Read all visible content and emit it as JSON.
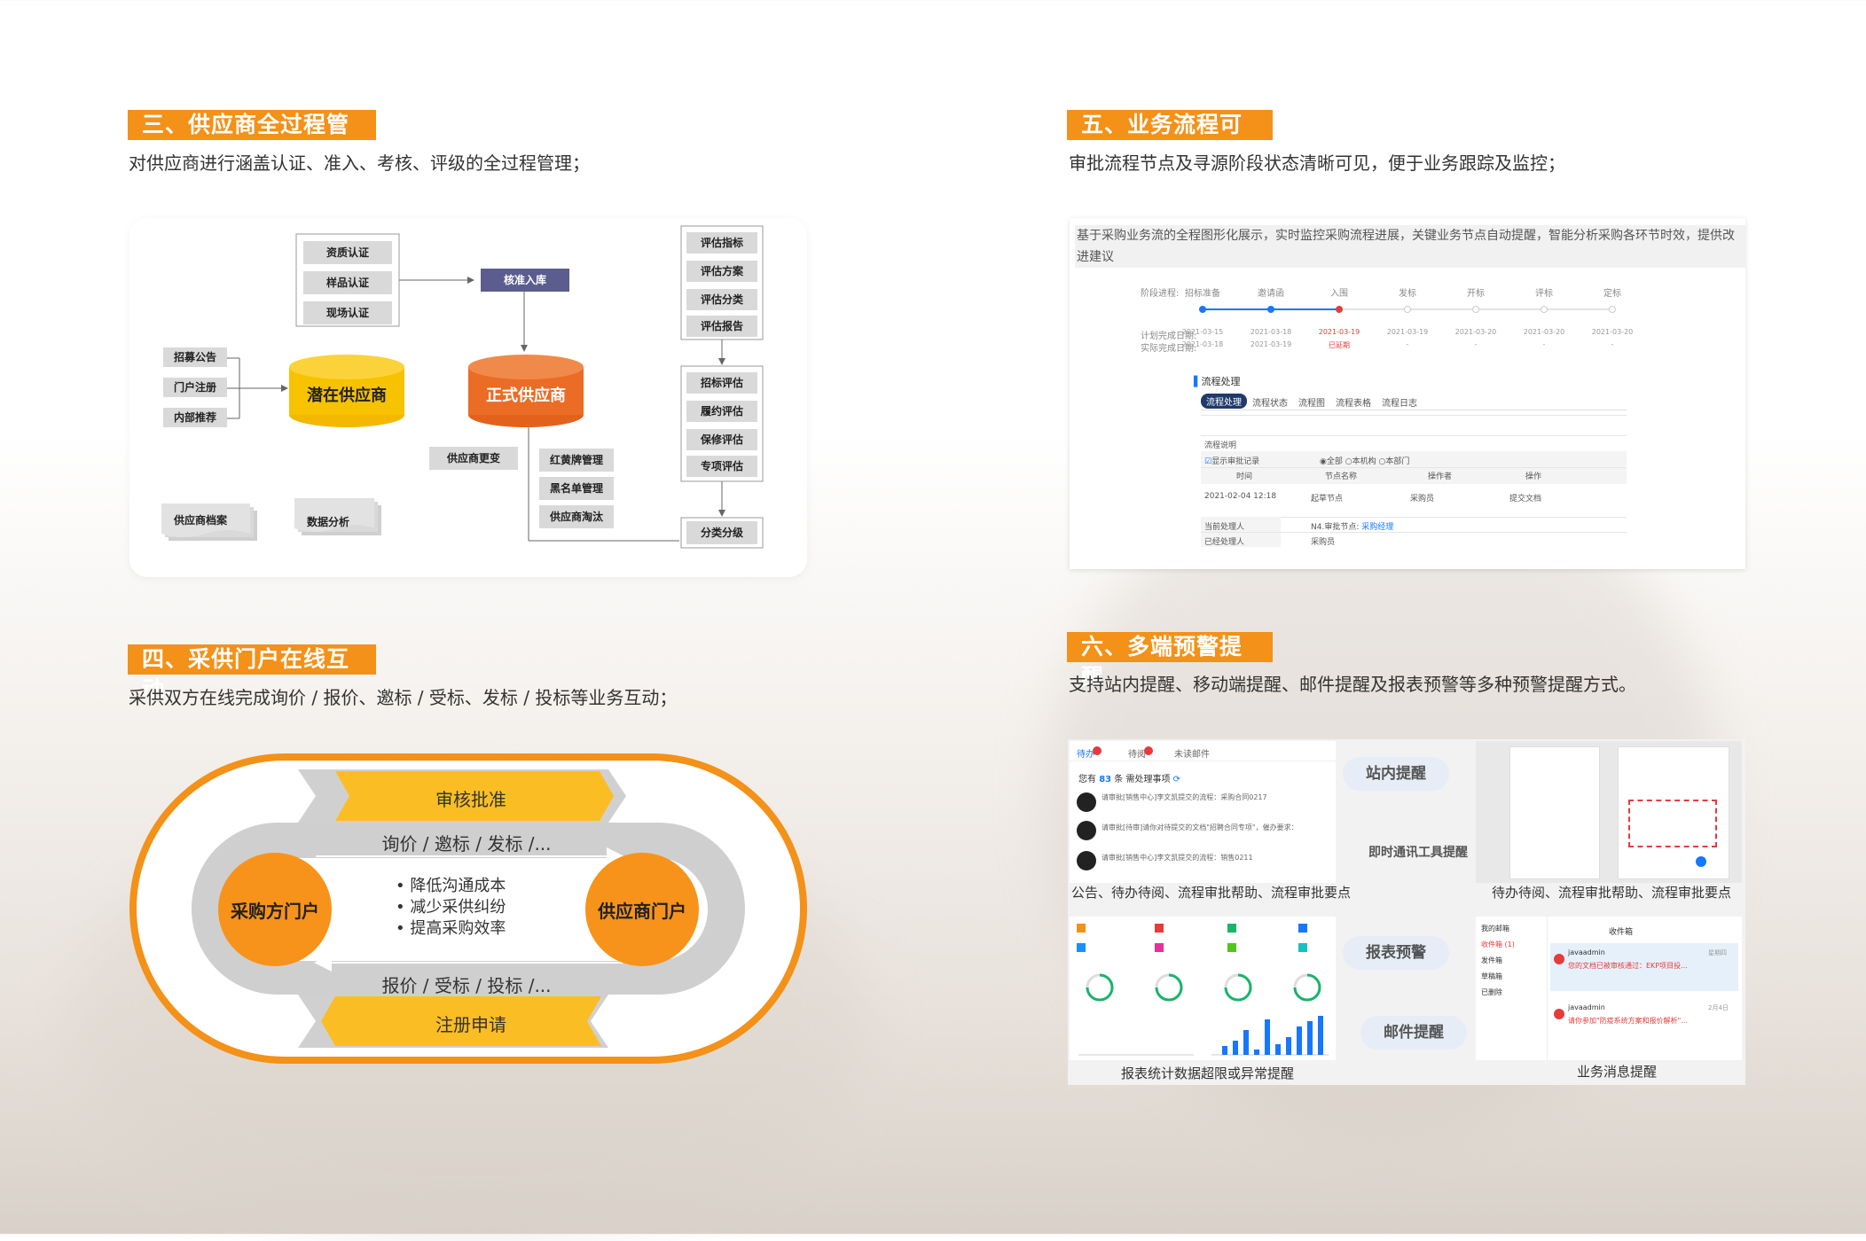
{
  "sections": {
    "s3": {
      "tag": "三、供应商全过程管理",
      "desc": "对供应商进行涵盖认证、准入、考核、评级的全过程管理；"
    },
    "s4": {
      "tag": "四、采供门户在线互动",
      "desc": "采供双方在线完成询价 / 报价、邀标 / 受标、发标 / 投标等业务互动；"
    },
    "s5": {
      "tag": "五、业务流程可视化",
      "desc": "审批流程节点及寻源阶段状态清晰可见，便于业务跟踪及监控；"
    },
    "s6": {
      "tag": "六、多端预警提醒",
      "desc": "支持站内提醒、移动端提醒、邮件提醒及报表预警等多种预警提醒方式。"
    }
  },
  "supplier_diagram": {
    "certs": [
      "资质认证",
      "样品认证",
      "现场认证"
    ],
    "approve": "核准入库",
    "sources": [
      "招募公告",
      "门户注册",
      "内部推荐"
    ],
    "potential": "潜在供应商",
    "formal": "正式供应商",
    "change": "供应商更变",
    "manage": [
      "红黄牌管理",
      "黑名单管理",
      "供应商淘汰"
    ],
    "eval_top": [
      "评估指标",
      "评估方案",
      "评估分类",
      "评估报告"
    ],
    "eval_mid": [
      "招标评估",
      "履约评估",
      "保修评估",
      "专项评估"
    ],
    "classify": "分类分级",
    "archive": "供应商档案",
    "analysis": "数据分析"
  },
  "portal_diagram": {
    "top_arrow": "审核批准",
    "bottom_arrow": "注册申请",
    "upper_flow": "询价 / 邀标 / 发标 /...",
    "lower_flow": "报价 / 受标 / 投标 /...",
    "left_circle": "采购方门户",
    "right_circle": "供应商门户",
    "bullets": [
      "降低沟通成本",
      "减少采供纠纷",
      "提高采购效率"
    ]
  },
  "process_panel": {
    "intro": "基于采购业务流的全程图形化展示，实时监控采购流程进展，关键业务节点自动提醒，智能分析采购各环节时效，提供改进建议",
    "stage_label": "阶段进程:",
    "stages": [
      "招标准备",
      "邀请函",
      "入围",
      "发标",
      "开标",
      "评标",
      "定标"
    ],
    "plan_label": "计划完成日期:",
    "plan_dates": [
      "2021-03-15",
      "2021-03-18",
      "2021-03-19",
      "2021-03-19",
      "2021-03-20",
      "2021-03-20",
      "2021-03-20"
    ],
    "actual_label": "实际完成日期:",
    "actual_dates": [
      "2021-03-18",
      "2021-03-19",
      "已延期",
      "-",
      "-",
      "-",
      "-"
    ],
    "flow_title": "流程处理",
    "tabs": [
      "流程处理",
      "流程状态",
      "流程图",
      "流程表格",
      "流程日志"
    ],
    "desc_label": "流程说明",
    "checkbox_label": "显示审批记录",
    "radios": [
      "全部",
      "本机构",
      "本部门"
    ],
    "table_headers": [
      "时间",
      "节点名称",
      "操作者",
      "操作"
    ],
    "table_row": [
      "2021-02-04 12:18",
      "起草节点",
      "采购员",
      "提交文档"
    ],
    "current_label": "当前处理人",
    "current_value": "N4.审批节点: ",
    "current_link": "采购经理",
    "done_label": "已经处理人",
    "done_value": "采购员"
  },
  "alerts": {
    "labels": [
      "站内提醒",
      "即时通讯工具提醒",
      "报表预警",
      "邮件提醒"
    ],
    "captions": [
      "公告、待办待阅、流程审批帮助、流程审批要点",
      "待办待阅、流程审批帮助、流程审批要点",
      "报表统计数据超限或异常提醒",
      "业务消息提醒"
    ],
    "inbox": {
      "tabs": [
        "待办",
        "待阅",
        "未读邮件"
      ],
      "you_have": "您有",
      "count": "83",
      "unit": "条",
      "pending": "需处理事项",
      "items": [
        "请审批[销售中心]李文凯提交的流程：采购合同0217",
        "请审批[待审]请你对待提交的文档\"招聘合同专项\"，催办要求：",
        "请审批[销售中心]李文凯提交的流程：销售0211"
      ]
    },
    "mail": {
      "sidebar": [
        "我的邮箱",
        "收件箱 (1)",
        "发件箱",
        "草稿箱",
        "已删除"
      ],
      "tab": "收件箱",
      "items": [
        {
          "from": "javaadmin",
          "subject": "您的文档已被审核通过：EKP项目投..."
        },
        {
          "from": "javaadmin",
          "subject": "请你参加\"防疫系统方案和报价解析\"..."
        }
      ],
      "dates": [
        "星期四",
        "2月4日"
      ]
    }
  },
  "colors": {
    "orange": "#f39118",
    "orange_dark": "#ee8a0b",
    "yellow": "#fbbf24",
    "blue_stage": "#1677ff",
    "red_stage": "#e63b3b",
    "navy_box": "#5b5d8e"
  }
}
